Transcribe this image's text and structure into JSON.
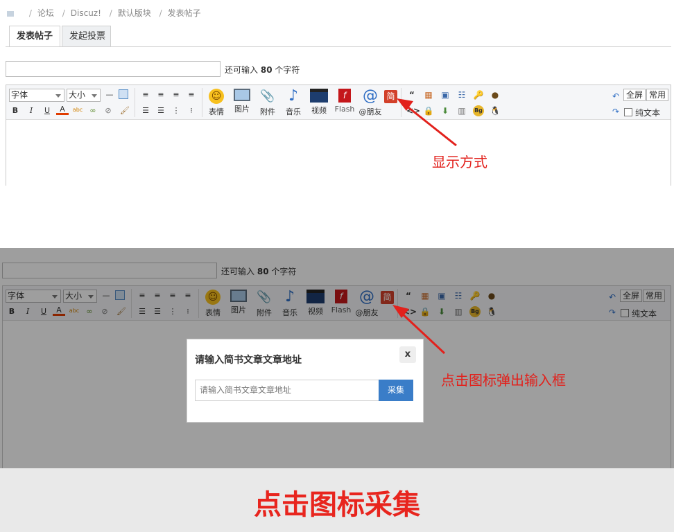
{
  "breadcrumb": {
    "items": [
      "论坛",
      "Discuz!",
      "默认版块",
      "发表帖子"
    ]
  },
  "tabs": [
    {
      "label": "发表帖子",
      "active": true
    },
    {
      "label": "发起投票",
      "active": false
    }
  ],
  "subject": {
    "value": "",
    "hint_prefix": "还可输入",
    "hint_count": "80",
    "hint_suffix": "个字符"
  },
  "toolbar": {
    "font_select": "字体",
    "size_select": "大小",
    "small_buttons": {
      "bold": "B",
      "italic": "I",
      "underline": "U",
      "color": "A",
      "spell": "abc"
    },
    "big_buttons": [
      {
        "label": "表情",
        "icon": "smiley-icon"
      },
      {
        "label": "图片",
        "icon": "image-icon"
      },
      {
        "label": "附件",
        "icon": "paperclip-icon"
      },
      {
        "label": "音乐",
        "icon": "music-note-icon"
      },
      {
        "label": "视频",
        "icon": "clapperboard-icon"
      },
      {
        "label": "Flash",
        "icon": "flash-icon"
      },
      {
        "label": "@朋友",
        "icon": "at-icon"
      }
    ],
    "jianshu_icon_text": "简",
    "quote_glyph": "“",
    "bg_badge": "Bg",
    "fullscreen_label": "全屏",
    "common_label": "常用",
    "plaintext_label": "纯文本"
  },
  "annotations": {
    "display_mode": "显示方式",
    "click_popup": "点击图标弹出输入框"
  },
  "modal": {
    "title": "请输入简书文章文章地址",
    "close": "x",
    "input_placeholder": "请输入简书文章文章地址",
    "submit_label": "采集"
  },
  "banner": {
    "text": "点击图标采集"
  },
  "colors": {
    "annotation_red": "#e2211c",
    "banner_red": "#e8251e",
    "button_blue": "#3a7dc8"
  }
}
